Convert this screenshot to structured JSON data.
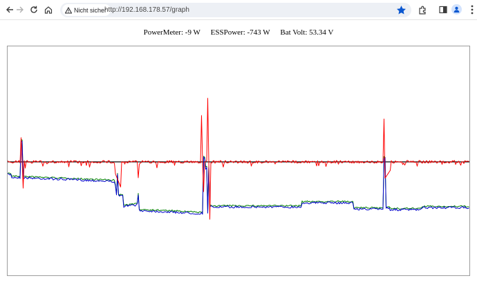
{
  "browser": {
    "nav_icons": [
      "back-arrow-icon",
      "forward-arrow-icon",
      "reload-icon",
      "home-icon"
    ],
    "security_label": "Nicht sicher",
    "url": "http://192.168.178.57/graph",
    "right_icons": [
      "bookmark-star-icon",
      "extensions-icon",
      "side-panel-icon",
      "profile-icon",
      "menu-kebab-icon"
    ],
    "star_color": "#0b57d0"
  },
  "readouts": [
    {
      "label": "PowerMeter:",
      "value": "-9 W"
    },
    {
      "label": "ESSPower:",
      "value": "-743 W"
    },
    {
      "label": "Bat Volt:",
      "value": "53.34 V"
    }
  ],
  "graph": {
    "series_colors": {
      "baseline": "#000000",
      "blue": "#0000cc",
      "green": "#008000",
      "red": "#ff0000"
    }
  }
}
